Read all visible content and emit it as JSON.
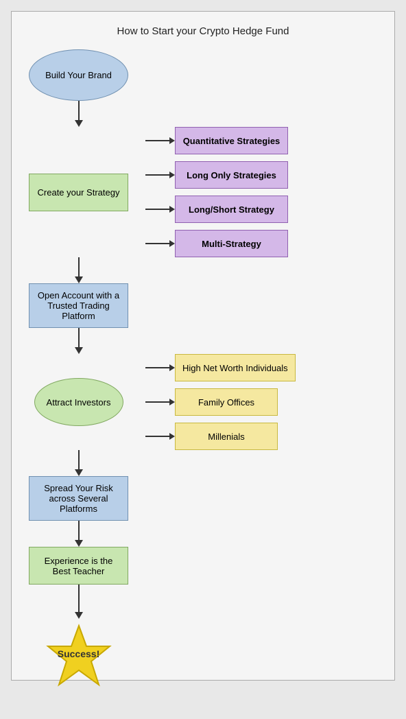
{
  "title": "How to Start your Crypto Hedge Fund",
  "nodes": {
    "build_brand": "Build Your Brand",
    "create_strategy": "Create your Strategy",
    "open_account": "Open Account with a Trusted Trading Platform",
    "attract_investors": "Attract Investors",
    "spread_risk": "Spread Your Risk across Several Platforms",
    "experience": "Experience is the Best Teacher",
    "success": "Success!"
  },
  "strategy_branches": [
    "Quantitative Strategies",
    "Long Only Strategies",
    "Long/Short Strategy",
    "Multi-Strategy"
  ],
  "investor_branches": [
    "High Net Worth Individuals",
    "Family Offices",
    "Millenials"
  ]
}
